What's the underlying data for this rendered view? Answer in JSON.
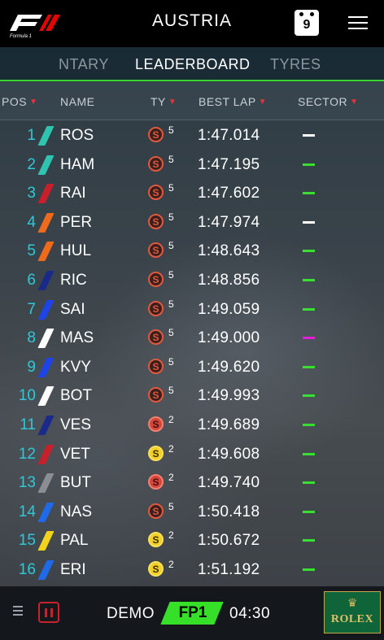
{
  "header": {
    "title": "AUSTRIA",
    "calendar_day": "9"
  },
  "tabs": {
    "prev": "NTARY",
    "active": "LEADERBOARD",
    "next": "TYRES"
  },
  "columns": {
    "pos": "POS",
    "name": "NAME",
    "tyre": "TY",
    "best_lap": "BEST LAP",
    "sector": "SECTOR",
    "sort_arrow": "▼"
  },
  "rows": [
    {
      "pos": "1",
      "name": "ROS",
      "tyre": "S",
      "tyre_type": "supersoft-used",
      "laps": "5",
      "best": "1:47.014",
      "team_color": "#2ec4b0",
      "sector_color": "#ffffff"
    },
    {
      "pos": "2",
      "name": "HAM",
      "tyre": "S",
      "tyre_type": "supersoft-used",
      "laps": "5",
      "best": "1:47.195",
      "team_color": "#2ec4b0",
      "sector_color": "#38e030"
    },
    {
      "pos": "3",
      "name": "RAI",
      "tyre": "S",
      "tyre_type": "supersoft-used",
      "laps": "5",
      "best": "1:47.602",
      "team_color": "#c8202a",
      "sector_color": "#38e030"
    },
    {
      "pos": "4",
      "name": "PER",
      "tyre": "S",
      "tyre_type": "supersoft-used",
      "laps": "5",
      "best": "1:47.974",
      "team_color": "#f06a1c",
      "sector_color": "#ffffff"
    },
    {
      "pos": "5",
      "name": "HUL",
      "tyre": "S",
      "tyre_type": "supersoft-used",
      "laps": "5",
      "best": "1:48.643",
      "team_color": "#f06a1c",
      "sector_color": "#38e030"
    },
    {
      "pos": "6",
      "name": "RIC",
      "tyre": "S",
      "tyre_type": "supersoft-used",
      "laps": "5",
      "best": "1:48.856",
      "team_color": "#1a2a8a",
      "sector_color": "#38e030"
    },
    {
      "pos": "7",
      "name": "SAI",
      "tyre": "S",
      "tyre_type": "supersoft-used",
      "laps": "5",
      "best": "1:49.059",
      "team_color": "#1e44e8",
      "sector_color": "#38e030"
    },
    {
      "pos": "8",
      "name": "MAS",
      "tyre": "S",
      "tyre_type": "supersoft-used",
      "laps": "5",
      "best": "1:49.000",
      "team_color": "#ffffff",
      "sector_color": "#e020d8"
    },
    {
      "pos": "9",
      "name": "KVY",
      "tyre": "S",
      "tyre_type": "supersoft-used",
      "laps": "5",
      "best": "1:49.620",
      "team_color": "#1e44e8",
      "sector_color": "#38e030"
    },
    {
      "pos": "10",
      "name": "BOT",
      "tyre": "S",
      "tyre_type": "supersoft-used",
      "laps": "5",
      "best": "1:49.993",
      "team_color": "#ffffff",
      "sector_color": "#38e030"
    },
    {
      "pos": "11",
      "name": "VES",
      "tyre": "S",
      "tyre_type": "supersoft-new",
      "laps": "2",
      "best": "1:49.689",
      "team_color": "#1a2a8a",
      "sector_color": "#38e030"
    },
    {
      "pos": "12",
      "name": "VET",
      "tyre": "S",
      "tyre_type": "soft-new",
      "laps": "2",
      "best": "1:49.608",
      "team_color": "#c8202a",
      "sector_color": "#38e030"
    },
    {
      "pos": "13",
      "name": "BUT",
      "tyre": "S",
      "tyre_type": "supersoft-new",
      "laps": "2",
      "best": "1:49.740",
      "team_color": "#8a8e92",
      "sector_color": "#38e030"
    },
    {
      "pos": "14",
      "name": "NAS",
      "tyre": "S",
      "tyre_type": "supersoft-used",
      "laps": "5",
      "best": "1:50.418",
      "team_color": "#1e6ae8",
      "sector_color": "#38e030"
    },
    {
      "pos": "15",
      "name": "PAL",
      "tyre": "S",
      "tyre_type": "soft-new",
      "laps": "2",
      "best": "1:50.672",
      "team_color": "#f2d21a",
      "sector_color": "#38e030"
    },
    {
      "pos": "16",
      "name": "ERI",
      "tyre": "S",
      "tyre_type": "soft-new",
      "laps": "2",
      "best": "1:51.192",
      "team_color": "#1e6ae8",
      "sector_color": "#38e030"
    }
  ],
  "footer": {
    "mode": "DEMO",
    "session": "FP1",
    "clock": "04:30",
    "sponsor": "ROLEX",
    "accent_color": "#36e028",
    "pause_color": "#c8232b"
  },
  "icons": [
    "f1-logo",
    "calendar-icon",
    "hamburger-menu-icon",
    "sort-arrow-icon",
    "grip-icon",
    "pause-icon",
    "rolex-crown-icon"
  ]
}
